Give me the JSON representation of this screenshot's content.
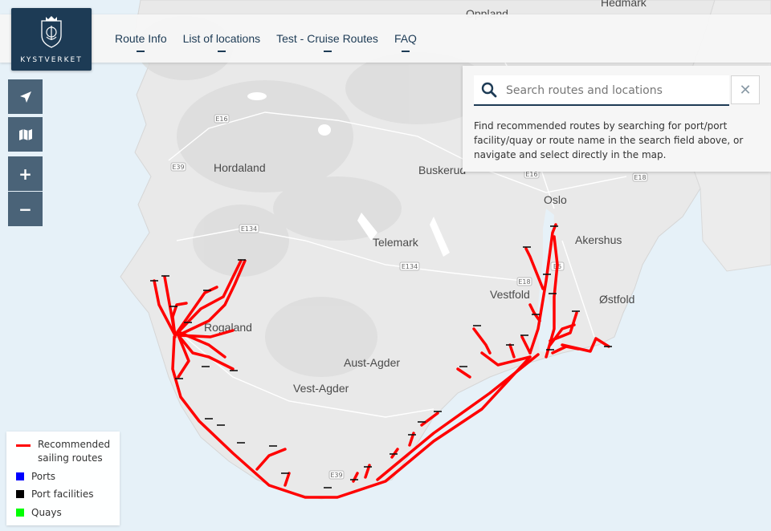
{
  "header": {
    "logo_text": "KYSTVERKET",
    "nav": [
      "Route Info",
      "List of locations",
      "Test - Cruise Routes",
      "FAQ"
    ]
  },
  "controls": {
    "locate": "location-arrow-icon",
    "layers": "map-icon",
    "zoom_in": "+",
    "zoom_out": "−"
  },
  "search": {
    "placeholder": "Search routes and locations",
    "value": "",
    "clear": "✕",
    "help": "Find recommended routes by searching for port/port facility/quay or route name in the search field above, or navigate and select directly in the map."
  },
  "map": {
    "places": [
      "Oppland",
      "Hedmark",
      "Hordaland",
      "Buskerud",
      "Oslo",
      "Akershus",
      "Telemark",
      "Vestfold",
      "Østfold",
      "Rogaland",
      "Aust-Agder",
      "Vest-Agder"
    ],
    "roads": [
      "E16",
      "E39",
      "E134",
      "E134",
      "E16",
      "E18",
      "E6",
      "E18",
      "E39"
    ],
    "colors": {
      "sea": "#e6f1f8",
      "land": "#e8e8e8",
      "route": "#ff0000"
    }
  },
  "legend": [
    {
      "label": "Recommended sailing routes",
      "color": "#ff0000",
      "kind": "line"
    },
    {
      "label": "Ports",
      "color": "#0000ff",
      "kind": "square"
    },
    {
      "label": "Port facilities",
      "color": "#000000",
      "kind": "square"
    },
    {
      "label": "Quays",
      "color": "#00ff00",
      "kind": "square"
    }
  ]
}
